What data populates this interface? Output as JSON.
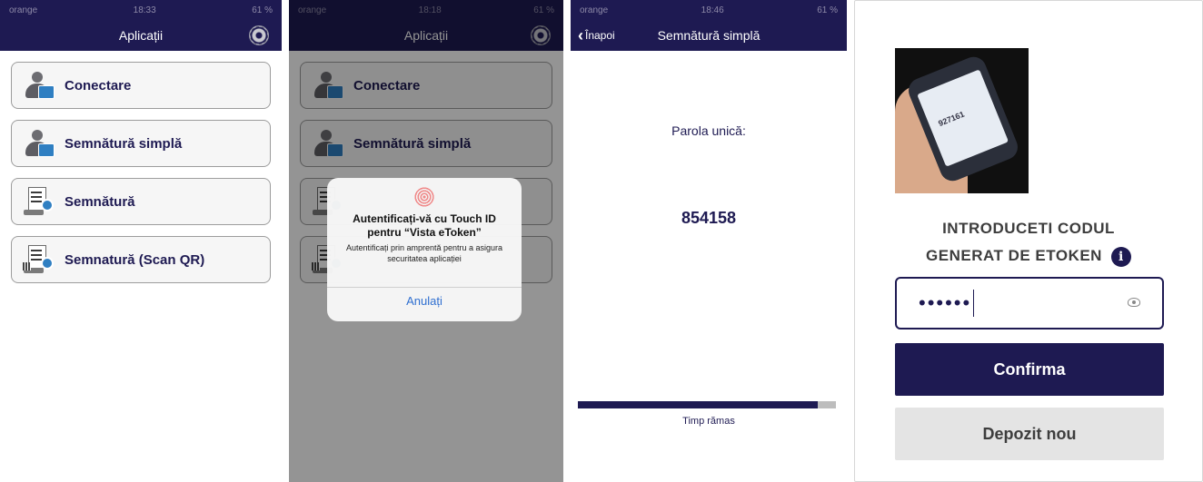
{
  "status": {
    "carrier": "orange",
    "battery": "61 %",
    "times": [
      "18:33",
      "18:18",
      "18:46"
    ]
  },
  "screen1": {
    "title": "Aplicații",
    "items": [
      {
        "label": "Conectare",
        "icon": "user-certificate-icon"
      },
      {
        "label": "Semnătură simplă",
        "icon": "user-certificate-icon"
      },
      {
        "label": "Semnătură",
        "icon": "document-sign-icon"
      },
      {
        "label": "Semnatură (Scan QR)",
        "icon": "qr-document-sign-icon"
      }
    ]
  },
  "screen2": {
    "title": "Aplicații",
    "items": [
      {
        "label": "Conectare"
      },
      {
        "label": "Semnătură simplă"
      }
    ],
    "dialog": {
      "title": "Autentificați-vă cu Touch ID pentru “Vista eToken”",
      "message": "Autentificați prin amprentă pentru a asigura securitatea aplicației",
      "cancel": "Anulați",
      "icon": "fingerprint-icon"
    }
  },
  "screen3": {
    "back_label": "Înapoi",
    "title": "Semnătură simplă",
    "otp_label": "Parola unică:",
    "otp_value": "854158",
    "progress_fraction": 0.93,
    "time_label": "Timp rămas"
  },
  "screen4": {
    "prompt_line1": "INTRODUCETI CODUL",
    "prompt_line2": "GENERAT DE ETOKEN",
    "code_masked": "••••••",
    "confirm_label": "Confirma",
    "new_deposit_label": "Depozit nou",
    "photo_code": "927161"
  },
  "colors": {
    "brand": "#1e1a52",
    "accent": "#2f6fd0",
    "secondary_button": "#e4e4e4"
  }
}
